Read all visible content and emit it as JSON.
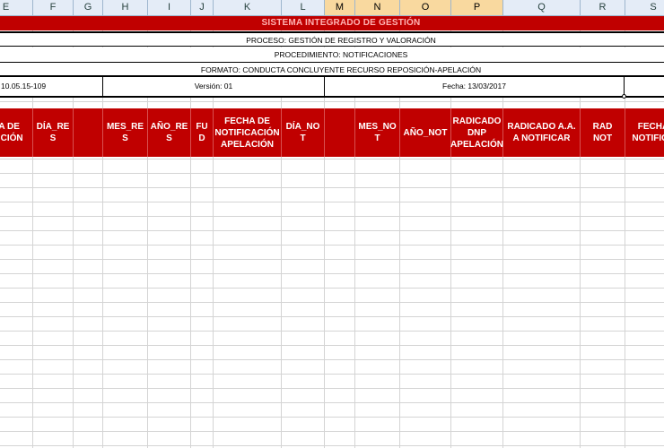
{
  "columns": [
    "E",
    "F",
    "G",
    "H",
    "I",
    "J",
    "K",
    "L",
    "M",
    "N",
    "O",
    "P",
    "Q",
    "R",
    "S"
  ],
  "selected_columns": [
    "M",
    "N",
    "O",
    "P"
  ],
  "title": "SISTEMA INTEGRADO DE GESTIÓN",
  "proceso": "PROCESO: GESTIÓN DE REGISTRO Y VALORACIÓN",
  "procedimiento": "PROCEDIMIENTO: NOTIFICACIONES",
  "formato": "FORMATO: CONDUCTA CONCLUYENTE RECURSO REPOSICIÓN-APELACIÓN",
  "code": "10.05.15-109",
  "version": "Versión: 01",
  "fecha": "Fecha: 13/03/2017",
  "headers": [
    "HA DE\nLUCIÓN",
    "DÍA_RE\nS",
    "",
    "MES_RE\nS",
    "AÑO_RE\nS",
    "FU\nD",
    "FECHA DE\nNOTIFICACIÓN\nAPELACIÓN",
    "DÍA_NO\nT",
    "",
    "MES_NO\nT",
    "AÑO_NOT",
    "RADICADO\nDNP\nAPELACIÓN",
    "RADICADO A.A.\nA NOTIFICAR",
    "RAD\nNOT",
    "FECHA\nNOTIFICA"
  ],
  "colors": {
    "header_red": "#c00000",
    "grid": "#d4d4d4",
    "col_header_bg": "#e4ecf7",
    "selected_col": "#f9d99f"
  }
}
